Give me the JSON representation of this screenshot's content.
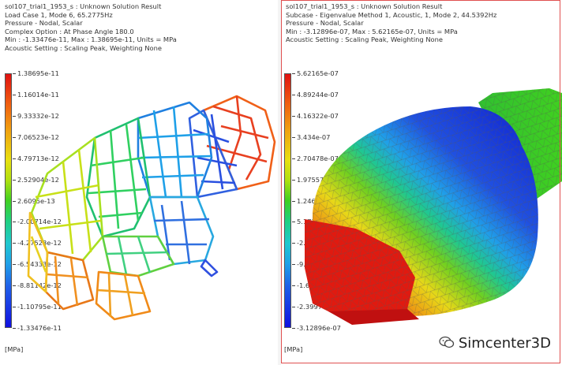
{
  "left_view": {
    "info_lines": [
      "sol107_trial1_1953_s : Unknown Solution Result",
      "Load Case 1, Mode 6, 65.2775Hz",
      "Pressure - Nodal, Scalar",
      "Complex Option : At Phase Angle 180.0",
      "Min : -1.33476e-11, Max : 1.38695e-11, Units = MPa",
      "Acoustic Setting : Scaling Peak, Weighting None"
    ],
    "scale_labels": [
      "1.38695e-11",
      "1.16014e-11",
      "9.33332e-12",
      "7.06523e-12",
      "4.79713e-12",
      "2.52904e-12",
      "2.6095e-13",
      "-2.00714e-12",
      "-4.27523e-12",
      "-6.54333e-12",
      "-8.81142e-12",
      "-1.10795e-11",
      "-1.33476e-11"
    ],
    "units": "[MPa]"
  },
  "right_view": {
    "info_lines": [
      "sol107_trial1_1953_s : Unknown Solution Result",
      "Subcase - Eigenvalue Method 1, Acoustic, 1, Mode 2, 44.5392Hz",
      "Pressure - Nodal, Scalar",
      "Min : -3.12896e-07, Max : 5.62165e-07, Units = MPa",
      "Acoustic Setting : Scaling Peak, Weighting None"
    ],
    "scale_labels": [
      "5.62165e-07",
      "4.89244e-07",
      "4.16322e-07",
      "3.434e-07",
      "2.70478e-07",
      "1.97557e-07",
      "1.24635e-07",
      "5.1713e-08",
      "-2.12081e-08",
      "-9.41306e-08",
      "-1.67052e-07",
      "-2.39974e-07",
      "-3.12896e-07"
    ],
    "units": "[MPa]"
  },
  "watermark": {
    "text": "Simcenter3D",
    "icon": "wechat-icon"
  },
  "colors": {
    "scale_top": "#e01010",
    "scale_bottom": "#1010e0",
    "frame": "#e05050"
  }
}
